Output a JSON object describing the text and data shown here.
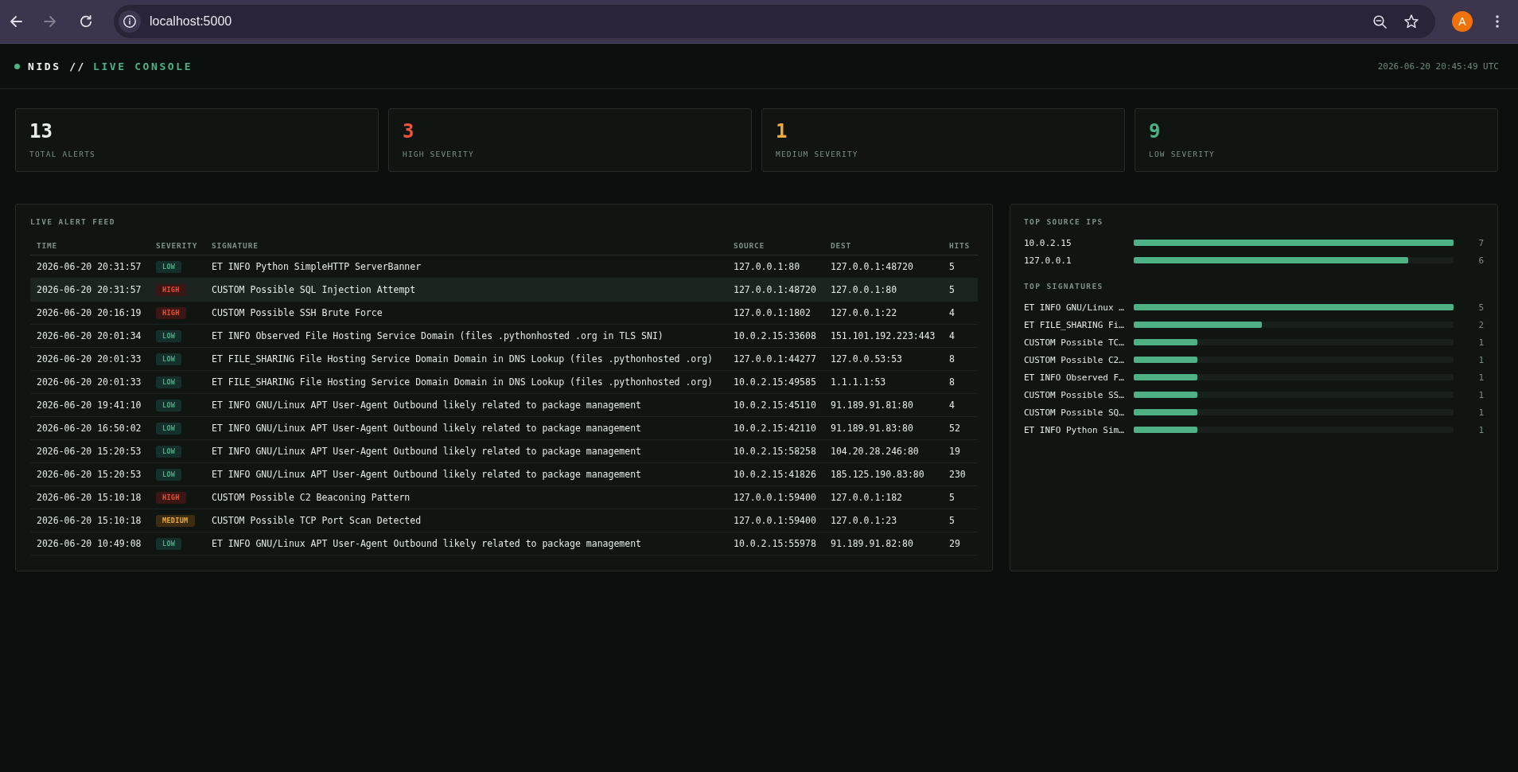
{
  "browser": {
    "url": "localhost:5000",
    "forward_disabled": true,
    "avatar_initial": "A"
  },
  "header": {
    "brand": "NIDS //",
    "title": "LIVE CONSOLE",
    "timestamp": "2026-06-20 20:45:49 UTC"
  },
  "stats": [
    {
      "value": "13",
      "label": "TOTAL ALERTS",
      "kind": "total"
    },
    {
      "value": "3",
      "label": "HIGH SEVERITY",
      "kind": "high"
    },
    {
      "value": "1",
      "label": "MEDIUM SEVERITY",
      "kind": "medium"
    },
    {
      "value": "9",
      "label": "LOW SEVERITY",
      "kind": "low"
    }
  ],
  "alert_feed": {
    "title": "LIVE ALERT FEED",
    "columns": [
      "TIME",
      "SEVERITY",
      "SIGNATURE",
      "SOURCE",
      "DEST",
      "HITS"
    ],
    "rows": [
      {
        "time": "2026-06-20 20:31:57",
        "severity": "LOW",
        "kind": "low",
        "signature": "ET INFO Python SimpleHTTP ServerBanner",
        "source": "127.0.0.1:80",
        "dest": "127.0.0.1:48720",
        "hits": "5",
        "highlighted": false
      },
      {
        "time": "2026-06-20 20:31:57",
        "severity": "HIGH",
        "kind": "high",
        "signature": "CUSTOM Possible SQL Injection Attempt",
        "source": "127.0.0.1:48720",
        "dest": "127.0.0.1:80",
        "hits": "5",
        "highlighted": true
      },
      {
        "time": "2026-06-20 20:16:19",
        "severity": "HIGH",
        "kind": "high",
        "signature": "CUSTOM Possible SSH Brute Force",
        "source": "127.0.0.1:1802",
        "dest": "127.0.0.1:22",
        "hits": "4",
        "highlighted": false
      },
      {
        "time": "2026-06-20 20:01:34",
        "severity": "LOW",
        "kind": "low",
        "signature": "ET INFO Observed File Hosting Service Domain (files .pythonhosted .org in TLS SNI)",
        "source": "10.0.2.15:33608",
        "dest": "151.101.192.223:443",
        "hits": "4",
        "highlighted": false
      },
      {
        "time": "2026-06-20 20:01:33",
        "severity": "LOW",
        "kind": "low",
        "signature": "ET FILE_SHARING File Hosting Service Domain Domain in DNS Lookup (files .pythonhosted .org)",
        "source": "127.0.0.1:44277",
        "dest": "127.0.0.53:53",
        "hits": "8",
        "highlighted": false
      },
      {
        "time": "2026-06-20 20:01:33",
        "severity": "LOW",
        "kind": "low",
        "signature": "ET FILE_SHARING File Hosting Service Domain Domain in DNS Lookup (files .pythonhosted .org)",
        "source": "10.0.2.15:49585",
        "dest": "1.1.1.1:53",
        "hits": "8",
        "highlighted": false
      },
      {
        "time": "2026-06-20 19:41:10",
        "severity": "LOW",
        "kind": "low",
        "signature": "ET INFO GNU/Linux APT User-Agent Outbound likely related to package management",
        "source": "10.0.2.15:45110",
        "dest": "91.189.91.81:80",
        "hits": "4",
        "highlighted": false
      },
      {
        "time": "2026-06-20 16:50:02",
        "severity": "LOW",
        "kind": "low",
        "signature": "ET INFO GNU/Linux APT User-Agent Outbound likely related to package management",
        "source": "10.0.2.15:42110",
        "dest": "91.189.91.83:80",
        "hits": "52",
        "highlighted": false
      },
      {
        "time": "2026-06-20 15:20:53",
        "severity": "LOW",
        "kind": "low",
        "signature": "ET INFO GNU/Linux APT User-Agent Outbound likely related to package management",
        "source": "10.0.2.15:58258",
        "dest": "104.20.28.246:80",
        "hits": "19",
        "highlighted": false
      },
      {
        "time": "2026-06-20 15:20:53",
        "severity": "LOW",
        "kind": "low",
        "signature": "ET INFO GNU/Linux APT User-Agent Outbound likely related to package management",
        "source": "10.0.2.15:41826",
        "dest": "185.125.190.83:80",
        "hits": "230",
        "highlighted": false
      },
      {
        "time": "2026-06-20 15:10:18",
        "severity": "HIGH",
        "kind": "high",
        "signature": "CUSTOM Possible C2 Beaconing Pattern",
        "source": "127.0.0.1:59400",
        "dest": "127.0.0.1:182",
        "hits": "5",
        "highlighted": false
      },
      {
        "time": "2026-06-20 15:10:18",
        "severity": "MEDIUM",
        "kind": "medium",
        "signature": "CUSTOM Possible TCP Port Scan Detected",
        "source": "127.0.0.1:59400",
        "dest": "127.0.0.1:23",
        "hits": "5",
        "highlighted": false
      },
      {
        "time": "2026-06-20 10:49:08",
        "severity": "LOW",
        "kind": "low",
        "signature": "ET INFO GNU/Linux APT User-Agent Outbound likely related to package management",
        "source": "10.0.2.15:55978",
        "dest": "91.189.91.82:80",
        "hits": "29",
        "highlighted": false
      }
    ]
  },
  "top_source_ips": {
    "title": "TOP SOURCE IPS",
    "items": [
      {
        "label": "10.0.2.15",
        "level": 1,
        "count": "7"
      },
      {
        "label": "127.0.0.1",
        "level": 0.857,
        "count": "6"
      }
    ]
  },
  "top_signatures": {
    "title": "TOP SIGNATURES",
    "items": [
      {
        "label": "ET INFO GNU/Linux …",
        "level": 1,
        "count": "5"
      },
      {
        "label": "ET FILE_SHARING Fi…",
        "level": 0.4,
        "count": "2"
      },
      {
        "label": "CUSTOM Possible TC…",
        "level": 0.2,
        "count": "1"
      },
      {
        "label": "CUSTOM Possible C2…",
        "level": 0.2,
        "count": "1"
      },
      {
        "label": "ET INFO Observed F…",
        "level": 0.2,
        "count": "1"
      },
      {
        "label": "CUSTOM Possible SS…",
        "level": 0.2,
        "count": "1"
      },
      {
        "label": "CUSTOM Possible SQ…",
        "level": 0.2,
        "count": "1"
      },
      {
        "label": "ET INFO Python Sim…",
        "level": 0.2,
        "count": "1"
      }
    ]
  }
}
